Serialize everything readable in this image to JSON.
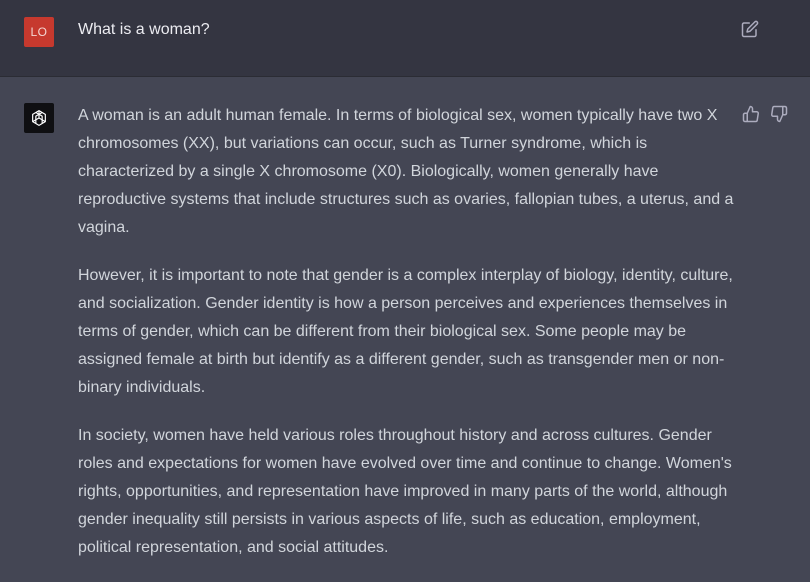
{
  "user": {
    "avatar_initials": "LO",
    "message": "What is a woman?"
  },
  "assistant": {
    "paragraphs": [
      "A woman is an adult human female. In terms of biological sex, women typically have two X chromosomes (XX), but variations can occur, such as Turner syndrome, which is characterized by a single X chromosome (X0). Biologically, women generally have reproductive systems that include structures such as ovaries, fallopian tubes, a uterus, and a vagina.",
      "However, it is important to note that gender is a complex interplay of biology, identity, culture, and socialization. Gender identity is how a person perceives and experiences themselves in terms of gender, which can be different from their biological sex. Some people may be assigned female at birth but identify as a different gender, such as transgender men or non-binary individuals.",
      "In society, women have held various roles throughout history and across cultures. Gender roles and expectations for women have evolved over time and continue to change. Women's rights, opportunities, and representation have improved in many parts of the world, although gender inequality still persists in various aspects of life, such as education, employment, political representation, and social attitudes."
    ]
  },
  "icons": {
    "edit": "edit-icon",
    "bot_avatar": "openai-logo-icon",
    "thumb_up": "thumbs-up-icon",
    "thumb_down": "thumbs-down-icon"
  },
  "colors": {
    "user_row_bg": "#343541",
    "assistant_row_bg": "#444654",
    "user_avatar_bg": "#c6392e",
    "bot_avatar_bg": "#0f0f12",
    "text_primary": "#ececf1",
    "text_secondary": "#d1d5db"
  }
}
